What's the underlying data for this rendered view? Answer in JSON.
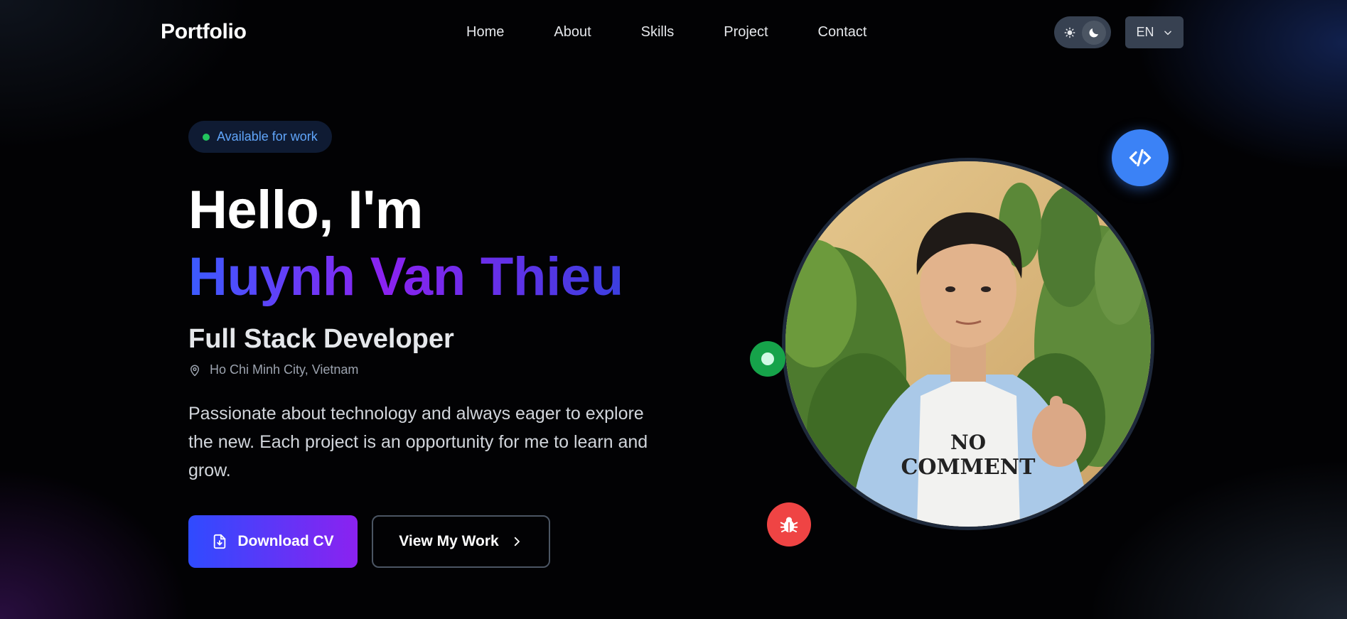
{
  "nav": {
    "brand": "Portfolio",
    "links": [
      {
        "label": "Home"
      },
      {
        "label": "About"
      },
      {
        "label": "Skills"
      },
      {
        "label": "Project"
      },
      {
        "label": "Contact"
      }
    ],
    "theme": {
      "light_icon": "sun-icon",
      "dark_icon": "moon-icon",
      "active": "dark"
    },
    "language": {
      "label": "EN",
      "icon": "chevron-down-icon"
    }
  },
  "hero": {
    "badge": "Available for work",
    "greeting": "Hello, I'm",
    "name": "Huynh Van Thieu",
    "role": "Full Stack Developer",
    "location": "Ho Chi Minh City, Vietnam",
    "description": "Passionate about technology and always eager to explore the new. Each project is an opportunity for me to learn and grow.",
    "primary_button": "Download CV",
    "secondary_button": "View My Work",
    "photo_shirt_text": "NO COMMENT"
  },
  "colors": {
    "accent_blue": "#3b82f6",
    "accent_purple": "#8b22f0",
    "status_green": "#22c55e",
    "bug_red": "#ef4444"
  },
  "floating_icons": [
    "code-icon",
    "status-dot-icon",
    "bug-icon"
  ]
}
